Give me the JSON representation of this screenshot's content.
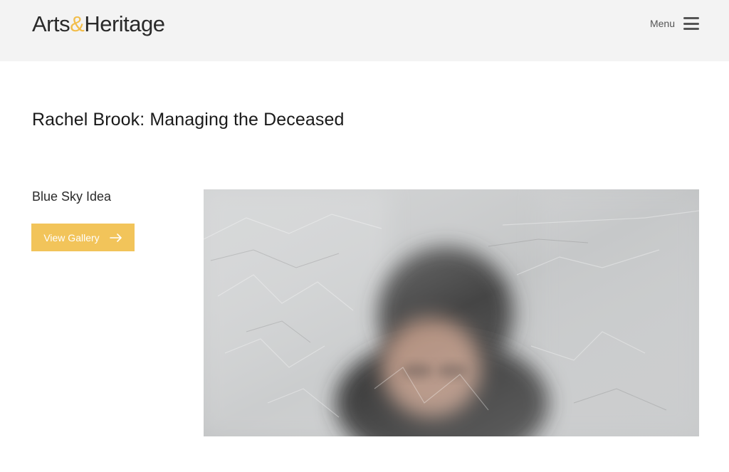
{
  "header": {
    "logo_part1": "Arts",
    "logo_amp": "&",
    "logo_part2": "Heritage",
    "menu_label": "Menu"
  },
  "main": {
    "title": "Rachel Brook: Managing the Deceased",
    "subtitle": "Blue Sky Idea",
    "gallery_button": "View Gallery"
  },
  "icons": {
    "menu": "hamburger-icon",
    "button_arrow": "arrow-right-icon"
  },
  "colors": {
    "header_bg": "#f3f3f3",
    "accent": "#f2c45a",
    "logo_amp": "#f2bd4a"
  }
}
